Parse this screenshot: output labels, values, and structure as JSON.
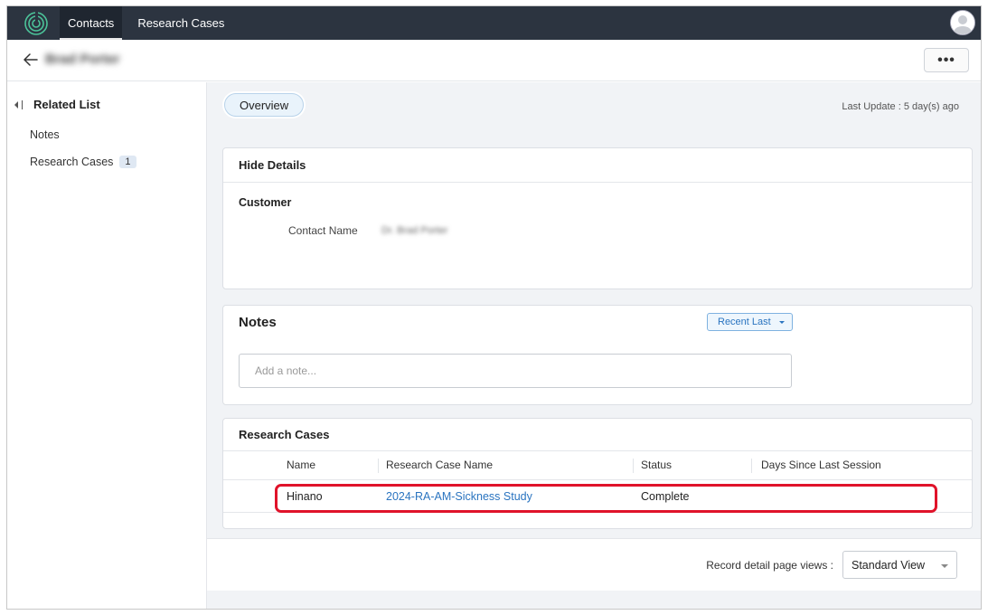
{
  "nav": {
    "tabs": [
      {
        "label": "Contacts",
        "active": true
      },
      {
        "label": "Research Cases",
        "active": false
      }
    ],
    "logo_icon": "spiral-logo-icon",
    "avatar_icon": "user-avatar-icon"
  },
  "header": {
    "record_title": "Brad Porter",
    "more_label": "•••"
  },
  "sidebar": {
    "heading": "Related List",
    "items": [
      {
        "label": "Notes"
      },
      {
        "label": "Research Cases",
        "count": "1"
      }
    ]
  },
  "main": {
    "overview_tab": "Overview",
    "last_update": "Last Update : 5 day(s) ago",
    "details": {
      "title": "Hide Details",
      "section": "Customer",
      "field_label": "Contact Name",
      "field_value": "Dr. Brad Porter"
    },
    "notes": {
      "title": "Notes",
      "sort_label": "Recent Last",
      "input_placeholder": "Add a note..."
    },
    "cases": {
      "title": "Research Cases",
      "columns": [
        "Name",
        "Research Case Name",
        "Status",
        "Days Since Last Session"
      ],
      "rows": [
        {
          "name": "Hinano",
          "case_name": "2024-RA-AM-Sickness Study",
          "status": "Complete",
          "days": ""
        }
      ]
    },
    "footer": {
      "views_label": "Record detail page views :",
      "selected_view": "Standard View"
    }
  },
  "colors": {
    "nav_bg": "#2c3440",
    "link": "#2a74c0",
    "highlight": "#e0132a"
  }
}
